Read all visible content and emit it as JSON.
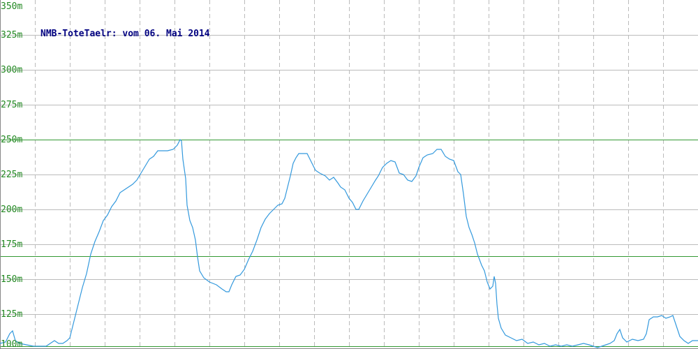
{
  "chart_data": {
    "type": "line",
    "title": "NMB-ToteTaelr: vom 06. Mai 2014",
    "xlabel": "",
    "ylabel": "",
    "ylim": [
      100,
      350
    ],
    "y_ticks": [
      100,
      125,
      150,
      175,
      200,
      225,
      250,
      275,
      300,
      325,
      350
    ],
    "y_tick_labels": [
      "100m",
      "125m",
      "150m",
      "175m",
      "200m",
      "225m",
      "250m",
      "275m",
      "300m",
      "325m",
      "350m"
    ],
    "x_range": [
      0,
      1000
    ],
    "x_gridlines": [
      50,
      100,
      150,
      200,
      250,
      300,
      350,
      400,
      450,
      500,
      550,
      600,
      650,
      700,
      750,
      800,
      850,
      900,
      950
    ],
    "reference_lines": [
      250,
      166.5,
      102
    ],
    "grid": true,
    "colors": {
      "line": "#3399dd",
      "tick_labels": "#228822",
      "title": "#000080",
      "reference_line": "#339933",
      "gridline": "#bbbbbb",
      "axis": "#888888"
    },
    "series": [
      {
        "values": [
          [
            0,
            104
          ],
          [
            8,
            105
          ],
          [
            14,
            111
          ],
          [
            18,
            113
          ],
          [
            22,
            106
          ],
          [
            28,
            104
          ],
          [
            38,
            103
          ],
          [
            48,
            102
          ],
          [
            58,
            102
          ],
          [
            66,
            102
          ],
          [
            72,
            104
          ],
          [
            78,
            106
          ],
          [
            84,
            104
          ],
          [
            90,
            104
          ],
          [
            96,
            106
          ],
          [
            100,
            108
          ],
          [
            104,
            116
          ],
          [
            108,
            124
          ],
          [
            112,
            132
          ],
          [
            118,
            144
          ],
          [
            124,
            154
          ],
          [
            130,
            168
          ],
          [
            136,
            177
          ],
          [
            142,
            184
          ],
          [
            148,
            192
          ],
          [
            154,
            196
          ],
          [
            160,
            202
          ],
          [
            166,
            206
          ],
          [
            172,
            212
          ],
          [
            178,
            214
          ],
          [
            184,
            216
          ],
          [
            190,
            218
          ],
          [
            196,
            221
          ],
          [
            202,
            226
          ],
          [
            208,
            231
          ],
          [
            214,
            236
          ],
          [
            220,
            238
          ],
          [
            226,
            242
          ],
          [
            232,
            242
          ],
          [
            240,
            242
          ],
          [
            248,
            243
          ],
          [
            254,
            246
          ],
          [
            258,
            250
          ],
          [
            260,
            249
          ],
          [
            262,
            236
          ],
          [
            266,
            222
          ],
          [
            268,
            203
          ],
          [
            272,
            192
          ],
          [
            276,
            187
          ],
          [
            280,
            178
          ],
          [
            283,
            166
          ],
          [
            286,
            156
          ],
          [
            292,
            151
          ],
          [
            300,
            148
          ],
          [
            310,
            146
          ],
          [
            318,
            143
          ],
          [
            324,
            141
          ],
          [
            328,
            141
          ],
          [
            332,
            146
          ],
          [
            338,
            152
          ],
          [
            344,
            153
          ],
          [
            350,
            157
          ],
          [
            356,
            164
          ],
          [
            362,
            170
          ],
          [
            368,
            178
          ],
          [
            374,
            187
          ],
          [
            380,
            193
          ],
          [
            386,
            197
          ],
          [
            392,
            200
          ],
          [
            398,
            203
          ],
          [
            404,
            204
          ],
          [
            408,
            208
          ],
          [
            412,
            216
          ],
          [
            416,
            224
          ],
          [
            420,
            233
          ],
          [
            424,
            237
          ],
          [
            428,
            240
          ],
          [
            434,
            240
          ],
          [
            440,
            240
          ],
          [
            446,
            234
          ],
          [
            452,
            228
          ],
          [
            458,
            226
          ],
          [
            466,
            224
          ],
          [
            472,
            221
          ],
          [
            478,
            223
          ],
          [
            484,
            219
          ],
          [
            488,
            216
          ],
          [
            494,
            214
          ],
          [
            500,
            208
          ],
          [
            505,
            205
          ],
          [
            510,
            200
          ],
          [
            514,
            200
          ],
          [
            520,
            206
          ],
          [
            526,
            211
          ],
          [
            532,
            216
          ],
          [
            538,
            221
          ],
          [
            542,
            224
          ],
          [
            548,
            230
          ],
          [
            554,
            233
          ],
          [
            560,
            235
          ],
          [
            566,
            234
          ],
          [
            572,
            226
          ],
          [
            578,
            225
          ],
          [
            584,
            221
          ],
          [
            590,
            220
          ],
          [
            596,
            224
          ],
          [
            600,
            230
          ],
          [
            606,
            237
          ],
          [
            612,
            239
          ],
          [
            620,
            240
          ],
          [
            626,
            243
          ],
          [
            632,
            243
          ],
          [
            638,
            238
          ],
          [
            644,
            236
          ],
          [
            650,
            235
          ],
          [
            656,
            227
          ],
          [
            660,
            225
          ],
          [
            664,
            211
          ],
          [
            668,
            195
          ],
          [
            672,
            187
          ],
          [
            676,
            182
          ],
          [
            680,
            176
          ],
          [
            684,
            168
          ],
          [
            690,
            160
          ],
          [
            694,
            156
          ],
          [
            698,
            148
          ],
          [
            702,
            143
          ],
          [
            706,
            145
          ],
          [
            708,
            152
          ],
          [
            710,
            147
          ],
          [
            712,
            132
          ],
          [
            714,
            122
          ],
          [
            718,
            115
          ],
          [
            724,
            110
          ],
          [
            732,
            108
          ],
          [
            740,
            106
          ],
          [
            748,
            107
          ],
          [
            756,
            104
          ],
          [
            764,
            105
          ],
          [
            772,
            103
          ],
          [
            780,
            104
          ],
          [
            788,
            102
          ],
          [
            796,
            103
          ],
          [
            804,
            102
          ],
          [
            812,
            103
          ],
          [
            820,
            102
          ],
          [
            828,
            103
          ],
          [
            836,
            104
          ],
          [
            844,
            103
          ],
          [
            850,
            102
          ],
          [
            856,
            101
          ],
          [
            862,
            102
          ],
          [
            868,
            103
          ],
          [
            874,
            104
          ],
          [
            880,
            106
          ],
          [
            884,
            111
          ],
          [
            888,
            114
          ],
          [
            892,
            108
          ],
          [
            898,
            105
          ],
          [
            906,
            107
          ],
          [
            914,
            106
          ],
          [
            922,
            107
          ],
          [
            926,
            111
          ],
          [
            930,
            121
          ],
          [
            936,
            123
          ],
          [
            942,
            123
          ],
          [
            948,
            124
          ],
          [
            954,
            122
          ],
          [
            960,
            123
          ],
          [
            964,
            124
          ],
          [
            968,
            118
          ],
          [
            974,
            109
          ],
          [
            980,
            106
          ],
          [
            986,
            104
          ],
          [
            992,
            106
          ],
          [
            1000,
            106
          ]
        ]
      }
    ]
  }
}
